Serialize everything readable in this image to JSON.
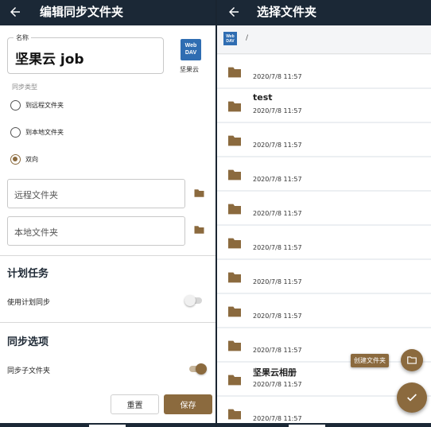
{
  "left": {
    "title": "编辑同步文件夹",
    "name_label": "名称",
    "name_value": "坚果云 job",
    "webdav_logo_line1": "Web",
    "webdav_logo_line2": "DAV",
    "webdav_caption": "坚果云",
    "sync_type_label": "同步类型",
    "sync_options": [
      {
        "label": "到远程文件夹",
        "selected": false
      },
      {
        "label": "到本地文件夹",
        "selected": false
      },
      {
        "label": "双向",
        "selected": true
      }
    ],
    "remote_placeholder": "远程文件夹",
    "local_placeholder": "本地文件夹",
    "schedule_title": "计划任务",
    "schedule_label": "使用计划同步",
    "schedule_enabled": false,
    "sync_options_title": "同步选项",
    "subfolder_label": "同步子文件夹",
    "subfolder_enabled": true,
    "reset_label": "重置",
    "save_label": "保存"
  },
  "right": {
    "title": "选择文件夹",
    "crumb_logo_line1": "Web",
    "crumb_logo_line2": "DAV",
    "crumb_path": "/",
    "folders": [
      {
        "name": "",
        "date": "2020/7/8 11:57"
      },
      {
        "name": "test",
        "date": "2020/7/8 11:57"
      },
      {
        "name": "",
        "date": "2020/7/8 11:57"
      },
      {
        "name": "",
        "date": "2020/7/8 11:57"
      },
      {
        "name": "",
        "date": "2020/7/8 11:57"
      },
      {
        "name": "",
        "date": "2020/7/8 11:57"
      },
      {
        "name": "",
        "date": "2020/7/8 11:57"
      },
      {
        "name": "",
        "date": "2020/7/8 11:57"
      },
      {
        "name": "",
        "date": "2020/7/8 11:57"
      },
      {
        "name": "坚果云相册",
        "date": "2020/7/8 11:57"
      },
      {
        "name": "",
        "date": "2020/7/8 11:57"
      }
    ],
    "create_folder_label": "创建文件夹"
  },
  "colors": {
    "appbar": "#1b2836",
    "accent": "#8b6a3e",
    "webdav": "#2f6db2"
  },
  "icons": {
    "back": "arrow-left-icon",
    "folder": "folder-icon",
    "create_folder": "folder-plus-icon",
    "confirm": "check-icon"
  }
}
